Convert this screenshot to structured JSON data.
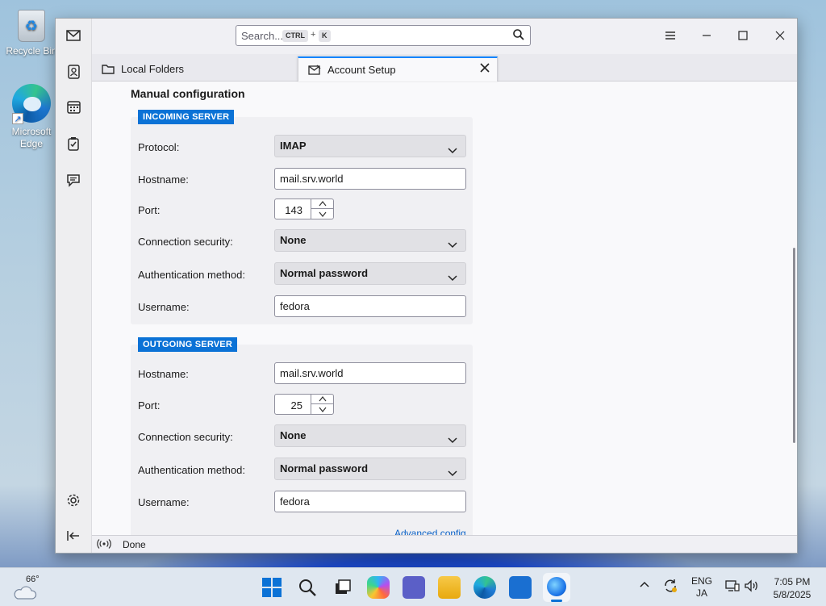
{
  "desktop": {
    "icons": [
      {
        "label": "Recycle Bin"
      },
      {
        "label": "Microsoft Edge"
      }
    ]
  },
  "window": {
    "search": {
      "placeholder": "Search...",
      "key1": "CTRL",
      "plus": "+",
      "key2": "K"
    },
    "tabs": [
      {
        "label": "Local Folders",
        "icon": "folder-icon",
        "active": false
      },
      {
        "label": "Account Setup",
        "icon": "mail-account-icon",
        "active": true
      }
    ],
    "spaces": [
      "mail-icon",
      "address-book-icon",
      "calendar-icon",
      "tasks-icon",
      "chat-icon",
      "settings-icon",
      "collapse-icon"
    ]
  },
  "form": {
    "heading": "Manual configuration",
    "incoming": {
      "legend": "INCOMING SERVER",
      "protocol_label": "Protocol:",
      "protocol_value": "IMAP",
      "hostname_label": "Hostname:",
      "hostname_value": "mail.srv.world",
      "port_label": "Port:",
      "port_value": "143",
      "security_label": "Connection security:",
      "security_value": "None",
      "auth_label": "Authentication method:",
      "auth_value": "Normal password",
      "username_label": "Username:",
      "username_value": "fedora"
    },
    "outgoing": {
      "legend": "OUTGOING SERVER",
      "hostname_label": "Hostname:",
      "hostname_value": "mail.srv.world",
      "port_label": "Port:",
      "port_value": "25",
      "security_label": "Connection security:",
      "security_value": "None",
      "auth_label": "Authentication method:",
      "auth_value": "Normal password",
      "username_label": "Username:",
      "username_value": "fedora"
    },
    "advanced_link": "Advanced config"
  },
  "status": {
    "text": "Done"
  },
  "taskbar": {
    "weather": "66°",
    "lang1": "ENG",
    "lang2": "JA",
    "time": "7:05 PM",
    "date": "5/8/2025",
    "accent": "#0b72d6"
  }
}
